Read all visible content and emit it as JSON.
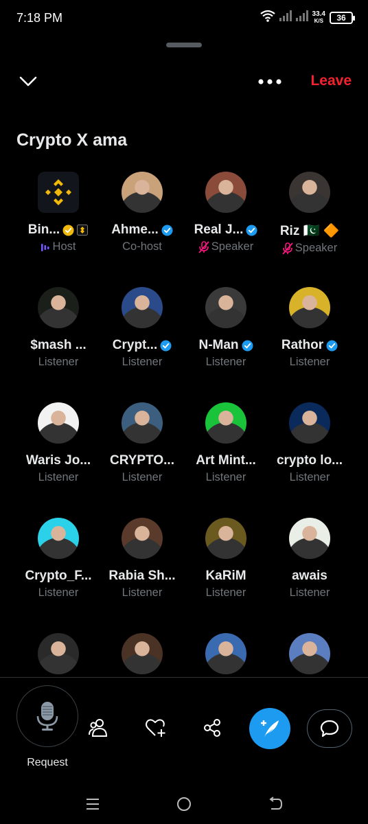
{
  "status_bar": {
    "time": "7:18 PM",
    "net_speed_value": "33.4",
    "net_speed_unit": "K/S",
    "battery": "36",
    "icons": [
      "wifi-icon",
      "signal-icon",
      "signal-icon",
      "battery-icon"
    ]
  },
  "header": {
    "collapse_icon": "chevron-down-icon",
    "more_icon": "more-icon",
    "leave_label": "Leave"
  },
  "space": {
    "title": "Crypto X ama"
  },
  "participants": [
    {
      "name": "Bin...",
      "role": "Host",
      "role_icon": "audio-bars-icon",
      "badges": [
        "verified-gold",
        "affiliate-badge"
      ],
      "avatar": "binance-logo"
    },
    {
      "name": "Ahme...",
      "role": "Co-host",
      "badges": [
        "verified-blue"
      ],
      "avatar": "photo"
    },
    {
      "name": "Real J...",
      "role": "Speaker",
      "role_icon": "mic-muted-icon",
      "badges": [
        "verified-blue"
      ],
      "avatar": "photo"
    },
    {
      "name": "Riz 🇵🇰 🔶",
      "role": "Speaker",
      "role_icon": "mic-muted-icon",
      "badges": [],
      "avatar": "photo"
    },
    {
      "name": "$mash ...",
      "role": "Listener",
      "badges": [],
      "avatar": "photo"
    },
    {
      "name": "Crypt...",
      "role": "Listener",
      "badges": [
        "verified-blue"
      ],
      "avatar": "photo"
    },
    {
      "name": "N-Man",
      "role": "Listener",
      "badges": [
        "verified-blue"
      ],
      "avatar": "photo"
    },
    {
      "name": "Rathor",
      "role": "Listener",
      "badges": [
        "verified-blue"
      ],
      "avatar": "photo"
    },
    {
      "name": "Waris Jo...",
      "role": "Listener",
      "badges": [],
      "avatar": "photo"
    },
    {
      "name": "CRYPTO...",
      "role": "Listener",
      "badges": [],
      "avatar": "photo"
    },
    {
      "name": "Art Mint...",
      "role": "Listener",
      "badges": [],
      "avatar": "photo"
    },
    {
      "name": "crypto lo...",
      "role": "Listener",
      "badges": [],
      "avatar": "photo"
    },
    {
      "name": "Crypto_F...",
      "role": "Listener",
      "badges": [],
      "avatar": "photo"
    },
    {
      "name": "Rabia Sh...",
      "role": "Listener",
      "badges": [],
      "avatar": "photo"
    },
    {
      "name": "KaRiM",
      "role": "Listener",
      "badges": [],
      "avatar": "photo"
    },
    {
      "name": "awais",
      "role": "Listener",
      "badges": [],
      "avatar": "photo"
    },
    {
      "name": "",
      "role": "",
      "badges": [],
      "avatar": "photo"
    },
    {
      "name": "",
      "role": "",
      "badges": [],
      "avatar": "photo"
    },
    {
      "name": "",
      "role": "",
      "badges": [],
      "avatar": "photo"
    },
    {
      "name": "",
      "role": "",
      "badges": [],
      "avatar": "photo"
    }
  ],
  "bottom_bar": {
    "mic_icon": "microphone-icon",
    "request_label": "Request",
    "actions": [
      "people-icon",
      "heart-plus-icon",
      "share-icon",
      "compose-icon",
      "chat-bubble-icon"
    ]
  },
  "nav_bar": {
    "icons": [
      "menu-icon",
      "home-icon",
      "back-icon"
    ]
  },
  "colors": {
    "background": "#000000",
    "accent": "#1d9bf0",
    "leave": "#f4212e",
    "muted_text": "#71767b",
    "gold": "#f0b90b",
    "host_purple": "#7856ff",
    "muted_mic": "#f91880"
  }
}
